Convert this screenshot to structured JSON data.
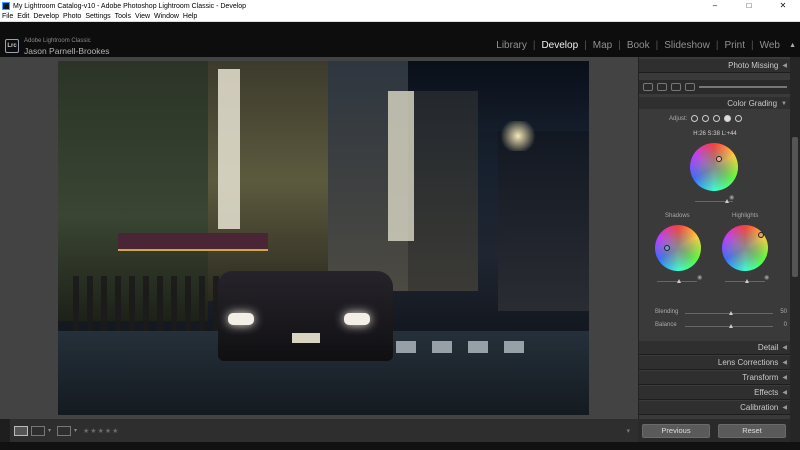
{
  "window": {
    "title": "My Lightroom Catalog-v10 - Adobe Photoshop Lightroom Classic - Develop",
    "minimize": "–",
    "maximize": "□",
    "close": "✕"
  },
  "menu": [
    "File",
    "Edit",
    "Develop",
    "Photo",
    "Settings",
    "Tools",
    "View",
    "Window",
    "Help"
  ],
  "identity": {
    "logo": "Lrc",
    "product": "Adobe Lightroom Classic",
    "user": "Jason Parnell-Brookes"
  },
  "modules": [
    {
      "label": "Library"
    },
    {
      "label": "Develop"
    },
    {
      "label": "Map"
    },
    {
      "label": "Book"
    },
    {
      "label": "Slideshow"
    },
    {
      "label": "Print"
    },
    {
      "label": "Web"
    }
  ],
  "active_module": "Develop",
  "separator": "|",
  "panels": {
    "photo_missing": "Photo Missing",
    "color_grading": "Color Grading",
    "adjust_label": "Adjust:",
    "hsl_readout": "H:26 S:38 L:+44",
    "shadows": "Shadows",
    "highlights": "Highlights",
    "blending": {
      "label": "Blending",
      "value": "50"
    },
    "balance": {
      "label": "Balance",
      "value": "0"
    },
    "detail": "Detail",
    "lens_corrections": "Lens Corrections",
    "transform": "Transform",
    "effects": "Effects",
    "calibration": "Calibration"
  },
  "toolbar": {
    "stars": "★★★★★"
  },
  "buttons": {
    "previous": "Previous",
    "reset": "Reset"
  },
  "icons": {
    "eye": "eye-icon",
    "triangle": "triangle-left-icon"
  }
}
